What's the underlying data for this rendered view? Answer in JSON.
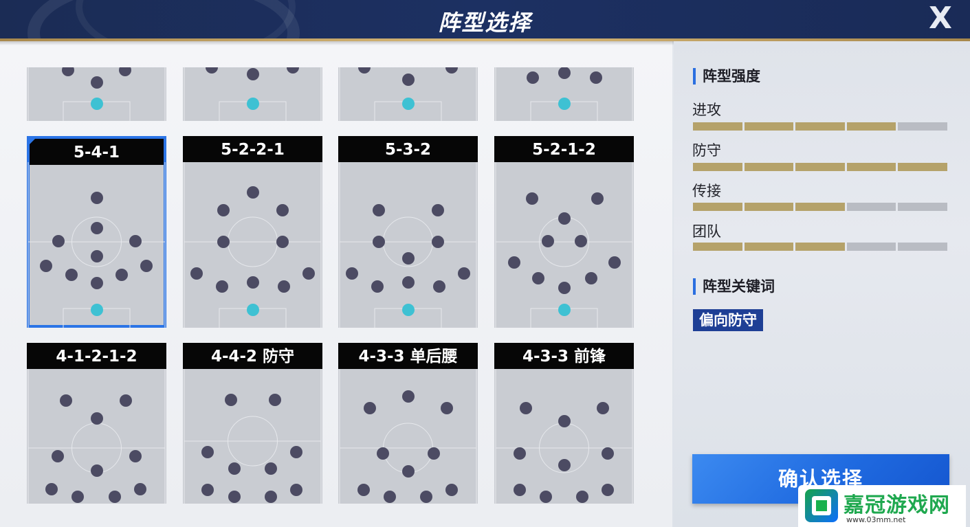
{
  "header": {
    "title": "阵型选择",
    "close_label": "X"
  },
  "formations": [
    {
      "name": "",
      "selected": false,
      "partial": true
    },
    {
      "name": "",
      "selected": false,
      "partial": true
    },
    {
      "name": "",
      "selected": false,
      "partial": true
    },
    {
      "name": "",
      "selected": false,
      "partial": true
    },
    {
      "name": "5-4-1",
      "selected": true
    },
    {
      "name": "5-2-2-1",
      "selected": false
    },
    {
      "name": "5-3-2",
      "selected": false
    },
    {
      "name": "5-2-1-2",
      "selected": false
    },
    {
      "name": "4-1-2-1-2",
      "selected": false
    },
    {
      "name": "4-4-2 防守",
      "selected": false
    },
    {
      "name": "4-3-3 单后腰",
      "selected": false
    },
    {
      "name": "4-3-3 前锋",
      "selected": false
    }
  ],
  "panel": {
    "strength_title": "阵型强度",
    "stats": [
      {
        "label": "进攻",
        "value": 4,
        "max": 5
      },
      {
        "label": "防守",
        "value": 5,
        "max": 5
      },
      {
        "label": "传接",
        "value": 3,
        "max": 5
      },
      {
        "label": "团队",
        "value": 3,
        "max": 5
      }
    ],
    "keywords_title": "阵型关键词",
    "keyword": "偏向防守",
    "confirm_label": "确认选择"
  },
  "colors": {
    "accent": "#2b74e6",
    "stat_on": "#b5a26a",
    "stat_off": "#b9bcc3",
    "player": "#4c4b63",
    "goalkeeper": "#3ec1d3"
  },
  "watermark": {
    "text": "嘉冠游戏网",
    "url": "www.03mm.net"
  }
}
